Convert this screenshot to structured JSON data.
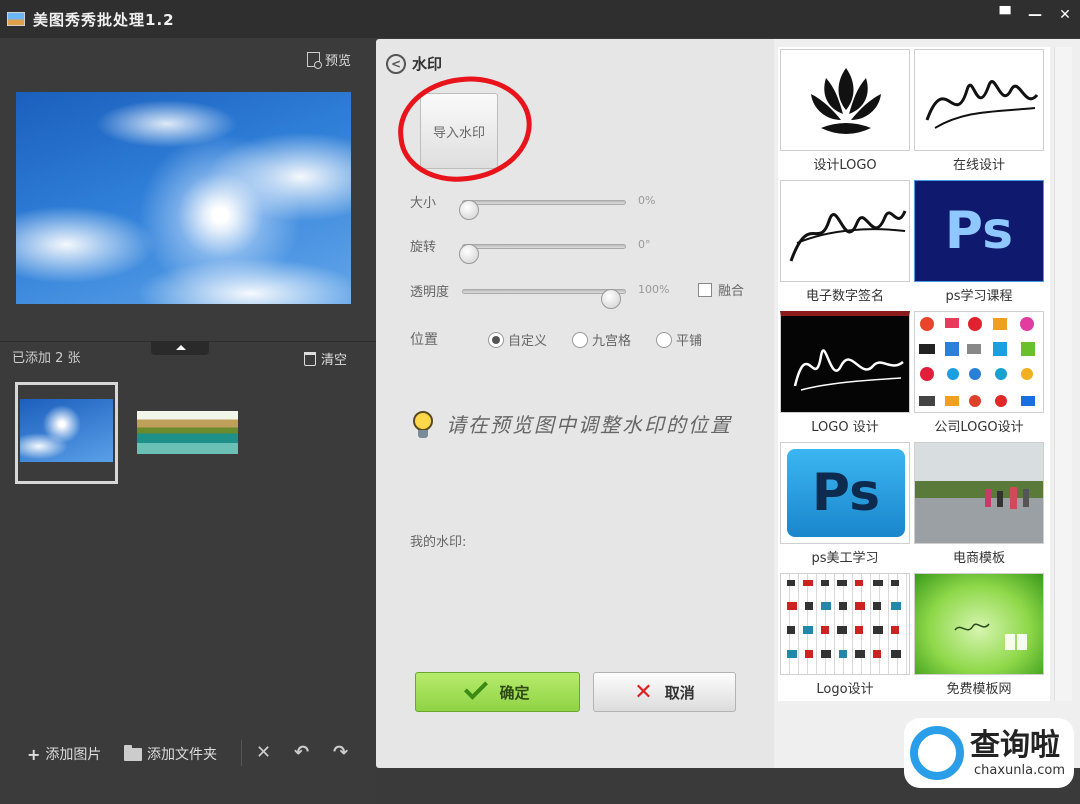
{
  "window": {
    "title": "美图秀秀批处理1.2",
    "controls": [
      "▀",
      "—",
      "✕"
    ]
  },
  "left_panel": {
    "preview_label": "预览",
    "added_label": "已添加 2 张",
    "clear_label": "清空",
    "bottom": {
      "add_image_label": "添加图片",
      "add_folder_label": "添加文件夹",
      "delete_glyph": "✕",
      "rotate_left_glyph": "↶",
      "rotate_right_glyph": "↷"
    }
  },
  "watermark_panel": {
    "title": "水印",
    "import_button": "导入水印",
    "sliders": [
      {
        "label": "大小",
        "value_text": "0%",
        "level": 0.0
      },
      {
        "label": "旋转",
        "value_text": "0°",
        "level": 0.0
      },
      {
        "label": "透明度",
        "value_text": "100%",
        "level": 1.0
      }
    ],
    "blend_label": "融合",
    "position": {
      "label": "位置",
      "options": [
        "自定义",
        "九宫格",
        "平铺"
      ],
      "selected": "自定义"
    },
    "tip": "请在预览图中调整水印的位置",
    "my_watermark_label": "我的水印:",
    "ok_label": "确定",
    "cancel_label": "取消",
    "accent_green": "#9ad84f",
    "annotation_color": "#e8131b"
  },
  "gallery": {
    "items": [
      {
        "label": "设计LOGO",
        "art": "lotus-logo"
      },
      {
        "label": "在线设计",
        "art": "signature"
      },
      {
        "label": "电子数字签名",
        "art": "signature"
      },
      {
        "label": "ps学习课程",
        "art": "ps-dark",
        "text": "Ps"
      },
      {
        "label": "LOGO 设计",
        "art": "signature-dark"
      },
      {
        "label": "公司LOGO设计",
        "art": "logo-grid"
      },
      {
        "label": "ps美工学习",
        "art": "ps-light",
        "text": "Ps"
      },
      {
        "label": "电商模板",
        "art": "street-photo"
      },
      {
        "label": "Logo设计",
        "art": "logo-sheet"
      },
      {
        "label": "免费模板网",
        "art": "green-template"
      }
    ]
  },
  "badge": {
    "cn": "查询啦",
    "en": "chaxunla.com"
  }
}
